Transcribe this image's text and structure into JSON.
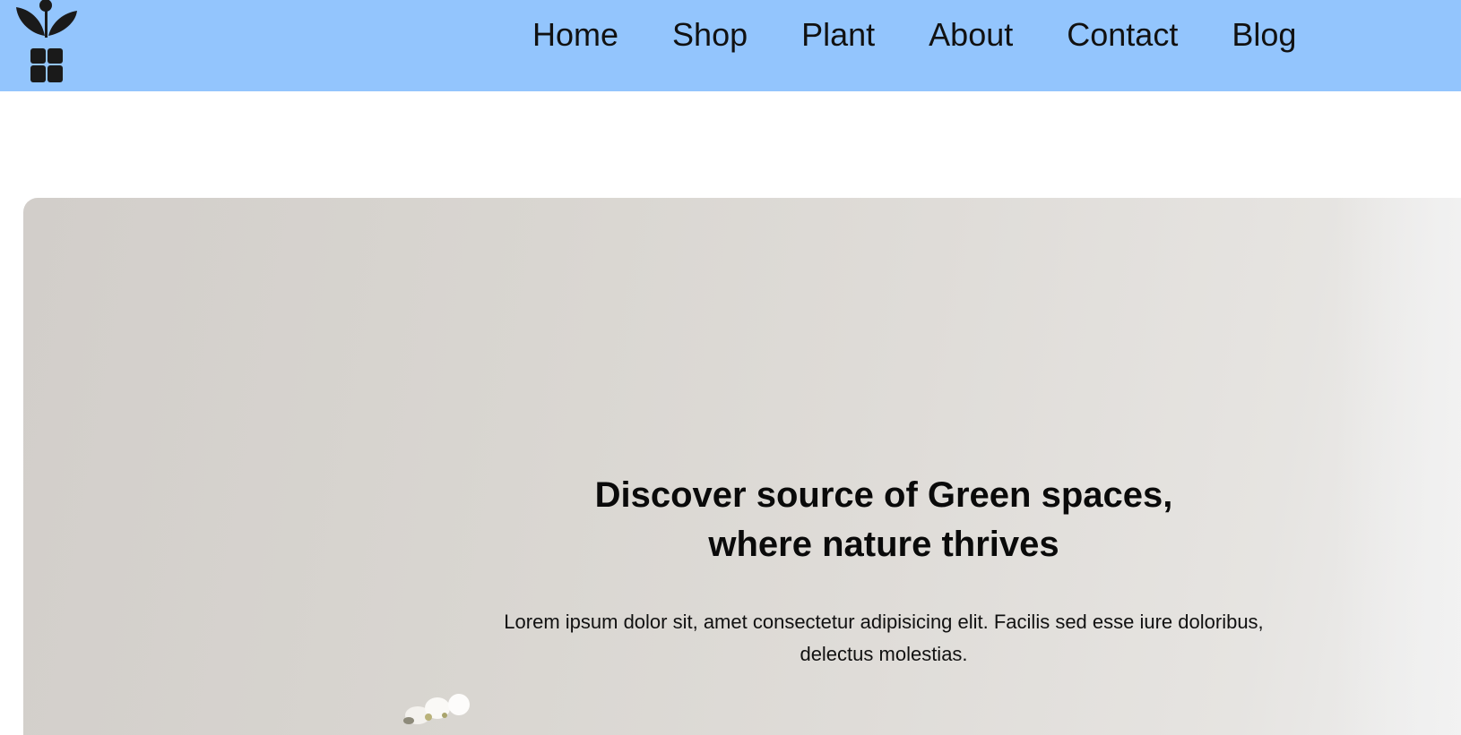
{
  "header": {
    "logo_icon": "potted-plant-logo",
    "background": "#93c5fd",
    "nav": [
      {
        "label": "Home"
      },
      {
        "label": "Shop"
      },
      {
        "label": "Plant"
      },
      {
        "label": "About"
      },
      {
        "label": "Contact"
      },
      {
        "label": "Blog"
      }
    ]
  },
  "hero": {
    "title_line1": "Discover source of Green spaces,",
    "title_line2": "where nature thrives",
    "text_line1": "Lorem ipsum dolor sit, amet consectetur adipisicing elit. Facilis sed esse iure doloribus,",
    "text_line2": "delectus molestias."
  }
}
